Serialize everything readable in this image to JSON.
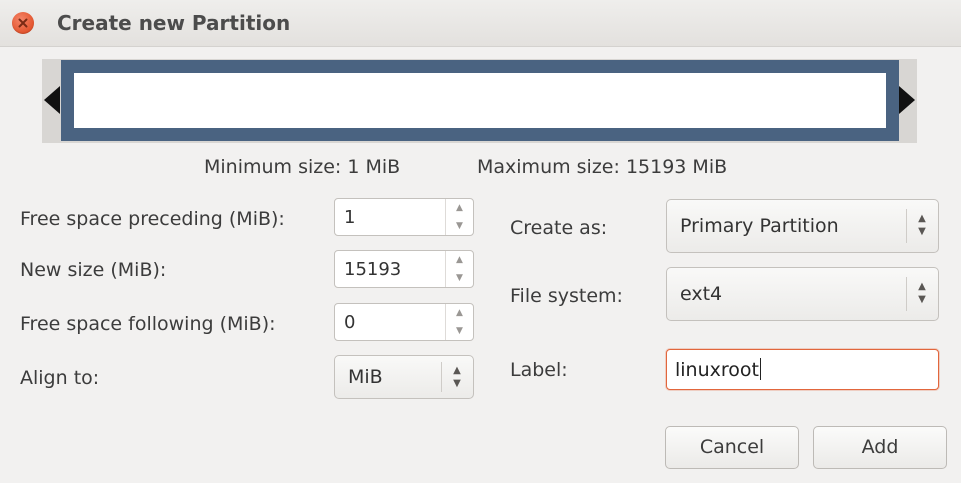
{
  "window": {
    "title": "Create new Partition"
  },
  "size_info": {
    "minimum": "Minimum size: 1 MiB",
    "maximum": "Maximum size: 15193 MiB"
  },
  "left_form": {
    "free_preceding": {
      "label": "Free space preceding (MiB):",
      "value": "1"
    },
    "new_size": {
      "label": "New size (MiB):",
      "value": "15193"
    },
    "free_following": {
      "label": "Free space following (MiB):",
      "value": "0"
    },
    "align_to": {
      "label": "Align to:",
      "value": "MiB"
    }
  },
  "right_form": {
    "create_as": {
      "label": "Create as:",
      "value": "Primary Partition"
    },
    "file_system": {
      "label": "File system:",
      "value": "ext4"
    },
    "label": {
      "label": "Label:",
      "value": "linuxroot"
    }
  },
  "buttons": {
    "cancel": "Cancel",
    "add": "Add"
  },
  "icons": {
    "close": "close-icon",
    "resize_left": "resize-left-arrow-icon",
    "resize_right": "resize-right-arrow-icon",
    "spin_up": "chevron-up-icon",
    "spin_down": "chevron-down-icon"
  },
  "colors": {
    "partition_border": "#4a6381",
    "close_button": "#e2542d",
    "focus_border": "#e2663c"
  }
}
